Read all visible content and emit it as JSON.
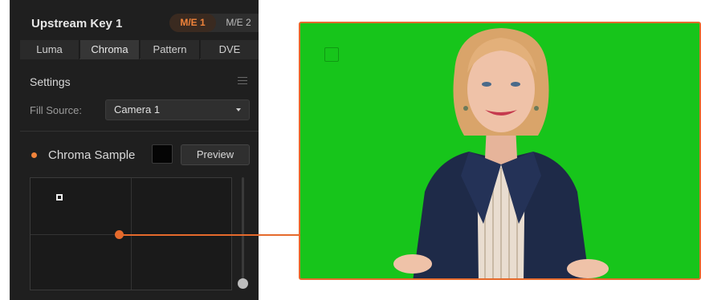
{
  "panel": {
    "title": "Upstream Key 1",
    "me_tabs": [
      {
        "label": "M/E 1",
        "active": true
      },
      {
        "label": "M/E 2",
        "active": false
      }
    ],
    "key_tabs": [
      {
        "label": "Luma",
        "active": false
      },
      {
        "label": "Chroma",
        "active": true
      },
      {
        "label": "Pattern",
        "active": false
      },
      {
        "label": "DVE",
        "active": false
      }
    ],
    "settings": {
      "title": "Settings",
      "menu_icon": "hamburger-menu-icon",
      "fill_source_label": "Fill Source:",
      "fill_source_value": "Camera 1"
    },
    "chroma_sample": {
      "label": "Chroma Sample",
      "status_color": "#f0833a",
      "swatch_color": "#050505",
      "preview_label": "Preview"
    }
  },
  "colors": {
    "accent": "#e56a2c",
    "panel_bg": "#1f1f1f",
    "green_screen": "#17c51b"
  }
}
